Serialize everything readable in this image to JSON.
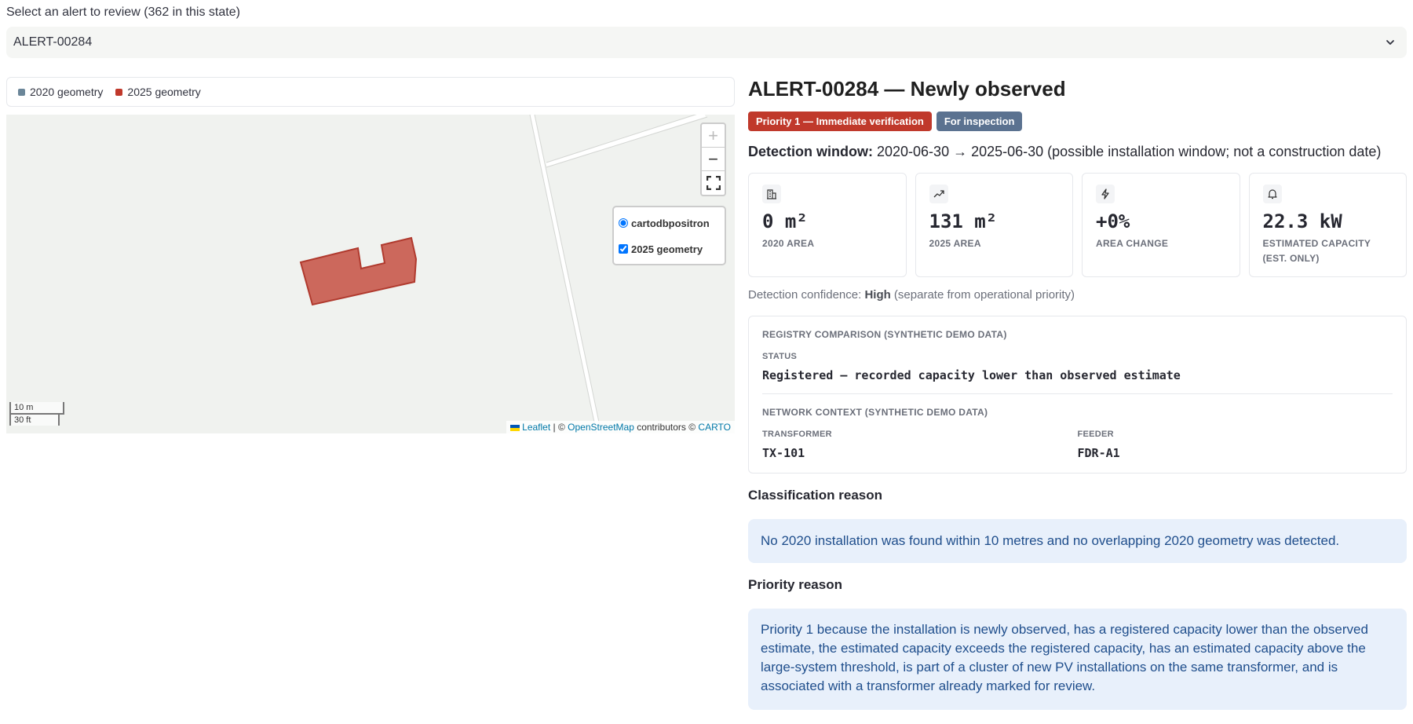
{
  "selector": {
    "label": "Select an alert to review (362 in this state)",
    "value": "ALERT-00284"
  },
  "map": {
    "legend": [
      {
        "label": "2020 geometry",
        "color": "#6b8699"
      },
      {
        "label": "2025 geometry",
        "color": "#c0392b"
      }
    ],
    "zoom_in": "+",
    "zoom_out": "−",
    "layers": {
      "base": "cartodbpositron",
      "overlay": "2025 geometry"
    },
    "scale": {
      "metric": "10 m",
      "imperial": "30 ft"
    },
    "attribution": {
      "leaflet": "Leaflet",
      "sep1": " | © ",
      "osm": "OpenStreetMap",
      "mid": " contributors © ",
      "carto": "CARTO"
    },
    "polygon_color": "#c0392b"
  },
  "alert": {
    "title": "ALERT-00284 — Newly observed",
    "badges": [
      {
        "label": "Priority 1 — Immediate verification",
        "color": "#c0392b"
      },
      {
        "label": "For inspection",
        "color": "#5b7290"
      }
    ],
    "detection_window_label": "Detection window:",
    "detection_window_value": " 2020-06-30 → 2025-06-30 (possible installation window; not a construction date)"
  },
  "metrics": [
    {
      "icon": "building-icon",
      "value": "0 m²",
      "label": "2020 area"
    },
    {
      "icon": "trend-up-icon",
      "value": "131 m²",
      "label": "2025 area"
    },
    {
      "icon": "lightning-icon",
      "value": "+0%",
      "label": "Area change"
    },
    {
      "icon": "bell-icon",
      "value": "22.3 kW",
      "label": "Estimated capacity (est. only)"
    }
  ],
  "confidence": {
    "prefix": "Detection confidence: ",
    "level": "High",
    "suffix": " (separate from operational priority)"
  },
  "registry": {
    "heading": "REGISTRY COMPARISON (SYNTHETIC DEMO DATA)",
    "status_label": "STATUS",
    "status_value": "Registered — recorded capacity lower than observed estimate",
    "network_heading": "NETWORK CONTEXT (SYNTHETIC DEMO DATA)",
    "transformer_label": "TRANSFORMER",
    "transformer_value": "TX-101",
    "feeder_label": "FEEDER",
    "feeder_value": "FDR-A1"
  },
  "classification": {
    "title": "Classification reason",
    "text": "No 2020 installation was found within 10 metres and no overlapping 2020 geometry was detected."
  },
  "priority": {
    "title": "Priority reason",
    "text": "Priority 1 because the installation is newly observed, has a registered capacity lower than the observed estimate, the estimated capacity exceeds the registered capacity, has an estimated capacity above the large-system threshold, is part of a cluster of new PV installations on the same transformer, and is associated with a transformer already marked for review."
  }
}
